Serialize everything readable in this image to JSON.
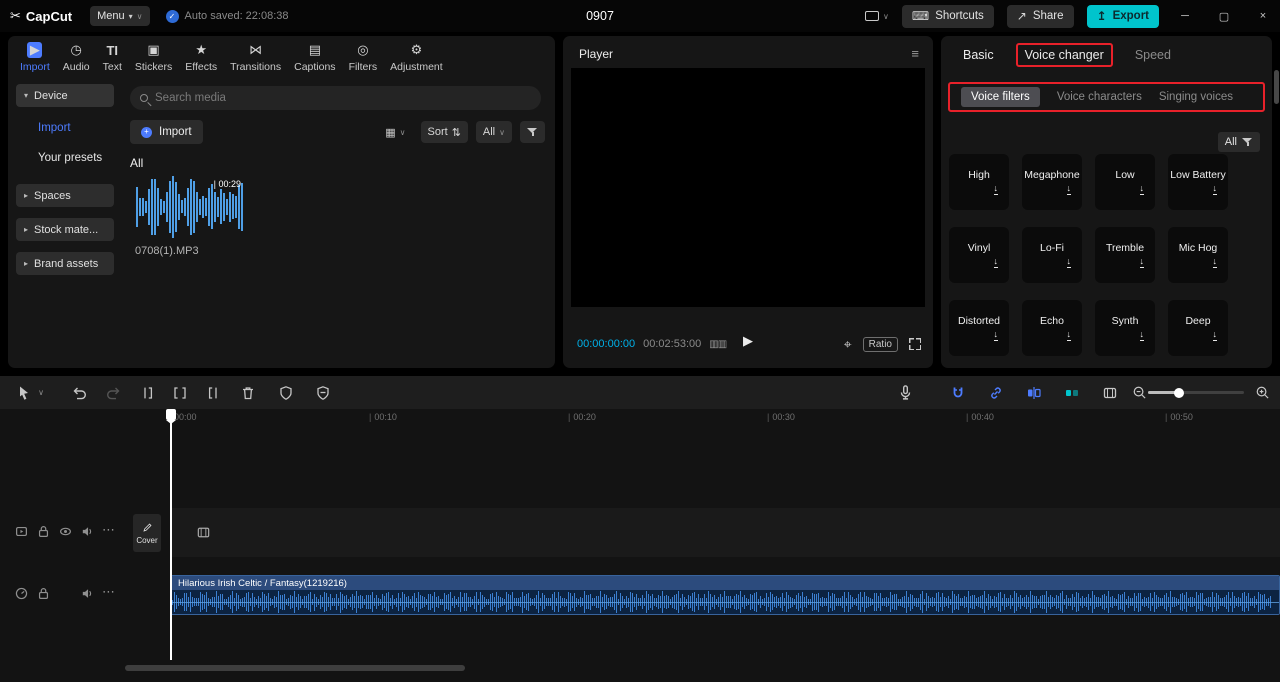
{
  "colors": {
    "accent_blue": "#4d7cff",
    "accent_cyan": "#00c4cc",
    "highlight_red": "#e8212a",
    "time_cyan": "#00b0e8",
    "wave_blue": "#4f9fe6",
    "clip_wave_blue": "#3b7fd0"
  },
  "titlebar": {
    "app_name": "CapCut",
    "menu_label": "Menu",
    "autosave_text": "Auto saved: 22:08:38",
    "document_title": "0907",
    "shortcuts_label": "Shortcuts",
    "share_label": "Share",
    "export_label": "Export"
  },
  "media_panel": {
    "tabs": [
      {
        "label": "Import"
      },
      {
        "label": "Audio"
      },
      {
        "label": "Text"
      },
      {
        "label": "Stickers"
      },
      {
        "label": "Effects"
      },
      {
        "label": "Transitions"
      },
      {
        "label": "Captions"
      },
      {
        "label": "Filters"
      },
      {
        "label": "Adjustment"
      }
    ],
    "active_tab": "Import",
    "sidebar": {
      "items": [
        {
          "label": "Device"
        },
        {
          "label": "Import"
        },
        {
          "label": "Your presets"
        },
        {
          "label": "Spaces"
        },
        {
          "label": "Stock mate..."
        },
        {
          "label": "Brand assets"
        }
      ]
    },
    "search_placeholder": "Search media",
    "import_button_label": "Import",
    "sort_label": "Sort",
    "all_filter_label": "All",
    "section_title": "All",
    "clip_duration": "00:29",
    "clip_filename": "0708(1).MP3"
  },
  "player": {
    "title": "Player",
    "current_time": "00:00:00:00",
    "duration": "00:02:53:00",
    "ratio_label": "Ratio"
  },
  "voice_panel": {
    "tabs": [
      {
        "label": "Basic"
      },
      {
        "label": "Voice changer"
      },
      {
        "label": "Speed"
      }
    ],
    "active_tab": "Voice changer",
    "subtabs": [
      {
        "label": "Voice filters"
      },
      {
        "label": "Voice characters"
      },
      {
        "label": "Singing voices"
      }
    ],
    "active_subtab": "Voice filters",
    "all_filter_label": "All",
    "filters": [
      {
        "name": "High"
      },
      {
        "name": "Megaphone"
      },
      {
        "name": "Low"
      },
      {
        "name": "Low Battery"
      },
      {
        "name": "Vinyl"
      },
      {
        "name": "Lo-Fi"
      },
      {
        "name": "Tremble"
      },
      {
        "name": "Mic Hog"
      },
      {
        "name": "Distorted"
      },
      {
        "name": "Echo"
      },
      {
        "name": "Synth"
      },
      {
        "name": "Deep"
      }
    ]
  },
  "timeline": {
    "ruler": [
      "00:00",
      "00:10",
      "00:20",
      "00:30",
      "00:40",
      "00:50"
    ],
    "cover_label": "Cover",
    "audio_clip_title": "Hilarious Irish Celtic / Fantasy(1219216)"
  }
}
